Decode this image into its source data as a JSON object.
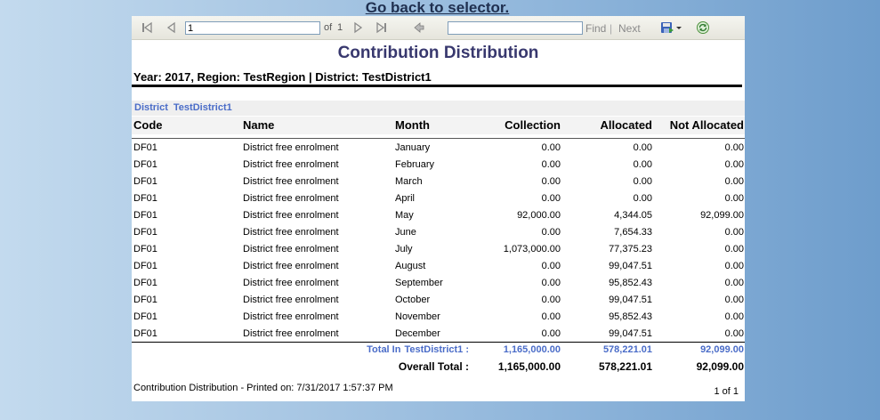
{
  "header_link": "Go back to selector.",
  "toolbar": {
    "page_value": "1",
    "of_label": "of",
    "total_pages": "1",
    "find_label": "Find",
    "separator": "|",
    "next_label": "Next",
    "icons": [
      "first-page-icon",
      "previous-page-icon",
      "next-page-icon",
      "last-page-icon",
      "back-to-parent-icon",
      "export-save-icon",
      "export-dropdown-icon",
      "refresh-icon"
    ]
  },
  "report": {
    "title": "Contribution Distribution",
    "subtitle": "Year: 2017, Region: TestRegion | District: TestDistrict1",
    "district_label": "District",
    "district_value": "TestDistrict1",
    "columns": [
      "Code",
      "Name",
      "Month",
      "Collection",
      "Allocated",
      "Not Allocated"
    ],
    "rows": [
      [
        "DF01",
        "District free enrolment",
        "January",
        "0.00",
        "0.00",
        "0.00"
      ],
      [
        "DF01",
        "District free enrolment",
        "February",
        "0.00",
        "0.00",
        "0.00"
      ],
      [
        "DF01",
        "District free enrolment",
        "March",
        "0.00",
        "0.00",
        "0.00"
      ],
      [
        "DF01",
        "District free enrolment",
        "April",
        "0.00",
        "0.00",
        "0.00"
      ],
      [
        "DF01",
        "District free enrolment",
        "May",
        "92,000.00",
        "4,344.05",
        "92,099.00"
      ],
      [
        "DF01",
        "District free enrolment",
        "June",
        "0.00",
        "7,654.33",
        "0.00"
      ],
      [
        "DF01",
        "District free enrolment",
        "July",
        "1,073,000.00",
        "77,375.23",
        "0.00"
      ],
      [
        "DF01",
        "District free enrolment",
        "August",
        "0.00",
        "99,047.51",
        "0.00"
      ],
      [
        "DF01",
        "District free enrolment",
        "September",
        "0.00",
        "95,852.43",
        "0.00"
      ],
      [
        "DF01",
        "District free enrolment",
        "October",
        "0.00",
        "99,047.51",
        "0.00"
      ],
      [
        "DF01",
        "District free enrolment",
        "November",
        "0.00",
        "95,852.43",
        "0.00"
      ],
      [
        "DF01",
        "District free enrolment",
        "December",
        "0.00",
        "99,047.51",
        "0.00"
      ]
    ],
    "district_total": {
      "label": "Total In",
      "district": "TestDistrict1 :",
      "collection": "1,165,000.00",
      "allocated": "578,221.01",
      "not_allocated": "92,099.00"
    },
    "overall_total": {
      "label": "Overall Total :",
      "collection": "1,165,000.00",
      "allocated": "578,221.01",
      "not_allocated": "92,099.00"
    },
    "footer": "Contribution Distribution - Printed on: 7/31/2017 1:57:37 PM",
    "page_indicator": "1 of 1"
  },
  "colors": {
    "title": "#38386e",
    "district_accent": "#4a6cc8",
    "toolbar_bg": "#ebeae3",
    "page_bg_start": "#c3daee",
    "page_bg_end": "#6e9dcc"
  }
}
